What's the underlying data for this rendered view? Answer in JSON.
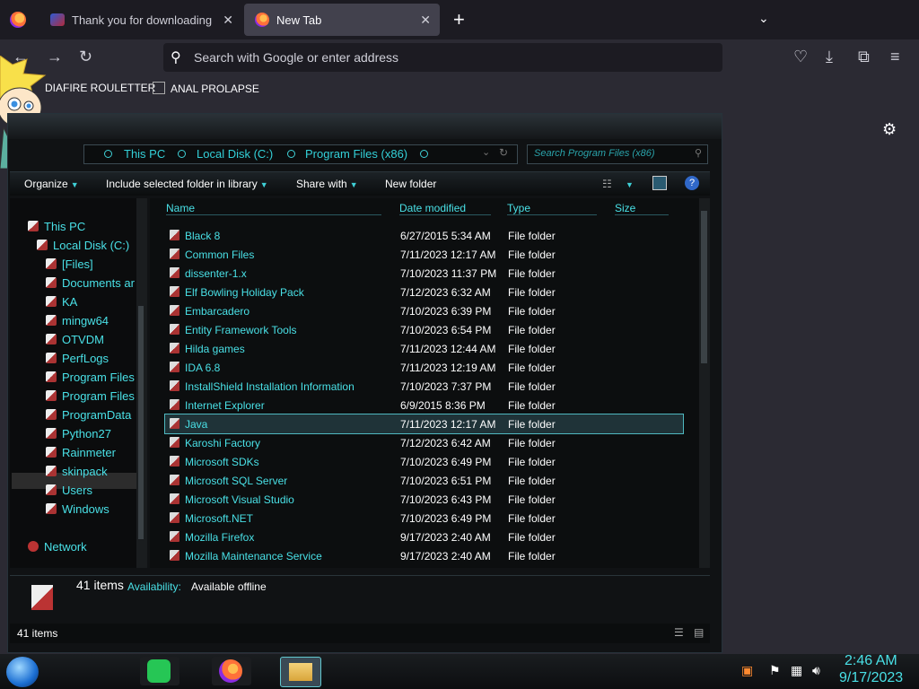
{
  "browser": {
    "tabs": [
      {
        "label": "Thank you for downloading Ma"
      },
      {
        "label": "New Tab"
      }
    ],
    "url_placeholder": "Search with Google or enter address",
    "bookmarks": [
      "DIAFIRE ROULETTER",
      "ANAL PROLAPSE"
    ]
  },
  "explorer": {
    "breadcrumbs": [
      "This PC",
      "Local Disk (C:)",
      "Program Files (x86)"
    ],
    "search_placeholder": "Search Program Files (x86)",
    "commands": {
      "organize": "Organize",
      "include": "Include selected folder in library",
      "share": "Share with",
      "new_folder": "New folder"
    },
    "nav": {
      "this_pc": "This PC",
      "local_disk": "Local Disk (C:)",
      "folders": [
        "[Files]",
        "Documents ar",
        "KA",
        "mingw64",
        "OTVDM",
        "PerfLogs",
        "Program Files",
        "Program Files",
        "ProgramData",
        "Python27",
        "Rainmeter",
        "skinpack",
        "Users",
        "Windows"
      ],
      "network": "Network"
    },
    "columns": {
      "name": "Name",
      "date": "Date modified",
      "type": "Type",
      "size": "Size"
    },
    "files": [
      {
        "name": "Black 8",
        "date": "6/27/2015 5:34 AM",
        "type": "File folder"
      },
      {
        "name": "Common Files",
        "date": "7/11/2023 12:17 AM",
        "type": "File folder"
      },
      {
        "name": "dissenter-1.x",
        "date": "7/10/2023 11:37 PM",
        "type": "File folder"
      },
      {
        "name": "Elf Bowling Holiday Pack",
        "date": "7/12/2023 6:32 AM",
        "type": "File folder"
      },
      {
        "name": "Embarcadero",
        "date": "7/10/2023 6:39 PM",
        "type": "File folder"
      },
      {
        "name": "Entity Framework Tools",
        "date": "7/10/2023 6:54 PM",
        "type": "File folder"
      },
      {
        "name": "Hilda games",
        "date": "7/11/2023 12:44 AM",
        "type": "File folder"
      },
      {
        "name": "IDA 6.8",
        "date": "7/11/2023 12:19 AM",
        "type": "File folder"
      },
      {
        "name": "InstallShield Installation Information",
        "date": "7/10/2023 7:37 PM",
        "type": "File folder"
      },
      {
        "name": "Internet Explorer",
        "date": "6/9/2015 8:36 PM",
        "type": "File folder"
      },
      {
        "name": "Java",
        "date": "7/11/2023 12:17 AM",
        "type": "File folder"
      },
      {
        "name": "Karoshi Factory",
        "date": "7/12/2023 6:42 AM",
        "type": "File folder"
      },
      {
        "name": "Microsoft SDKs",
        "date": "7/10/2023 6:49 PM",
        "type": "File folder"
      },
      {
        "name": "Microsoft SQL Server",
        "date": "7/10/2023 6:51 PM",
        "type": "File folder"
      },
      {
        "name": "Microsoft Visual Studio",
        "date": "7/10/2023 6:43 PM",
        "type": "File folder"
      },
      {
        "name": "Microsoft.NET",
        "date": "7/10/2023 6:49 PM",
        "type": "File folder"
      },
      {
        "name": "Mozilla Firefox",
        "date": "9/17/2023 2:40 AM",
        "type": "File folder"
      },
      {
        "name": "Mozilla Maintenance Service",
        "date": "9/17/2023 2:40 AM",
        "type": "File folder"
      }
    ],
    "details": {
      "count": "41 items",
      "availability_label": "Availability:",
      "availability": "Available offline"
    },
    "status_count": "41 items"
  },
  "taskbar": {
    "time": "2:46 AM",
    "date": "9/17/2023"
  },
  "icons": [
    "search-icon",
    "gear-icon",
    "back-icon",
    "forward-icon",
    "reload-icon",
    "pocket-icon",
    "download-icon",
    "extensions-icon",
    "menu-icon",
    "help-icon",
    "folder-icon"
  ]
}
